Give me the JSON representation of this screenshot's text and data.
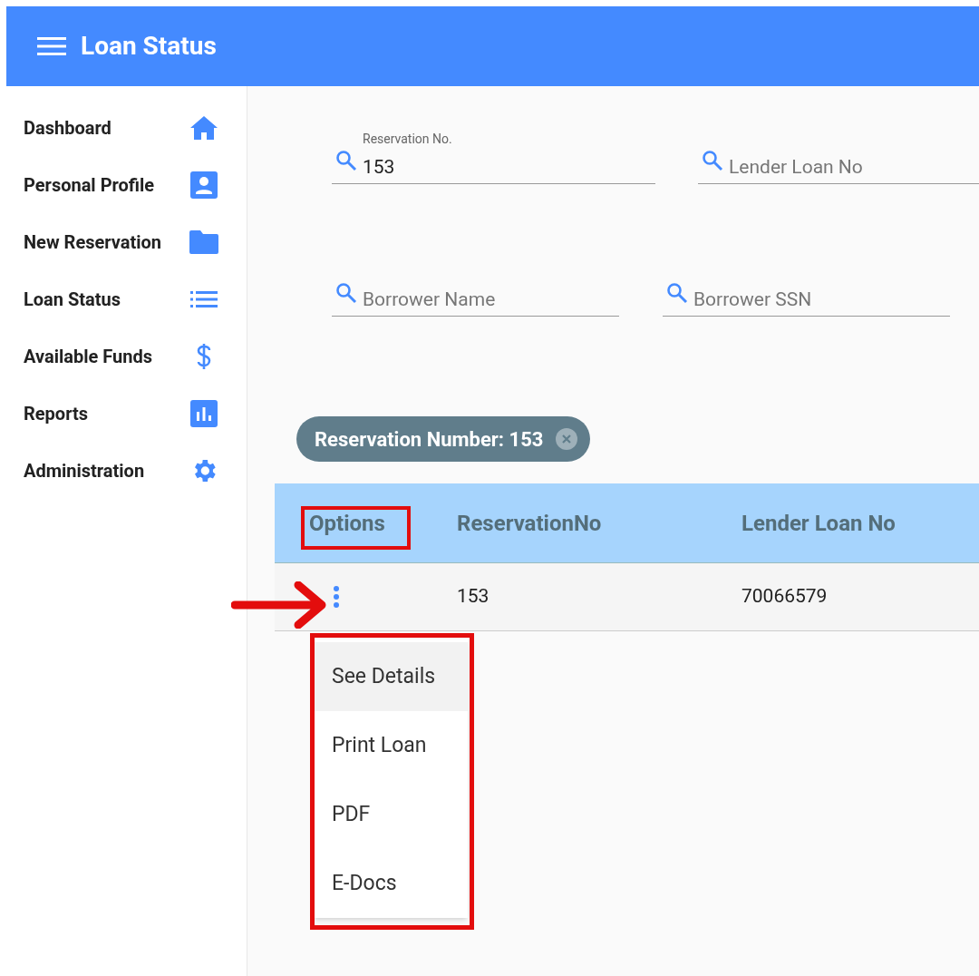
{
  "app_bar": {
    "title": "Loan Status"
  },
  "sidebar": {
    "items": [
      {
        "label": "Dashboard"
      },
      {
        "label": "Personal Profile"
      },
      {
        "label": "New Reservation"
      },
      {
        "label": "Loan Status"
      },
      {
        "label": "Available Funds"
      },
      {
        "label": "Reports"
      },
      {
        "label": "Administration"
      }
    ]
  },
  "filters": [
    [
      {
        "label": "Reservation No.",
        "value": "153"
      },
      {
        "placeholder": "Lender Loan No"
      }
    ],
    [
      {
        "placeholder": "Borrower Name"
      },
      {
        "placeholder": "Borrower SSN"
      }
    ]
  ],
  "chip": {
    "label": "Reservation Number: 153"
  },
  "table": {
    "columns": [
      "Options",
      "ReservationNo",
      "Lender Loan No"
    ],
    "rows": [
      [
        "",
        "153",
        "70066579"
      ]
    ]
  },
  "menu": {
    "items": [
      {
        "label": "See Details",
        "selected": true
      },
      {
        "label": "Print Loan",
        "selected": false
      },
      {
        "label": "PDF",
        "selected": false
      },
      {
        "label": "E-Docs",
        "selected": false
      }
    ]
  }
}
